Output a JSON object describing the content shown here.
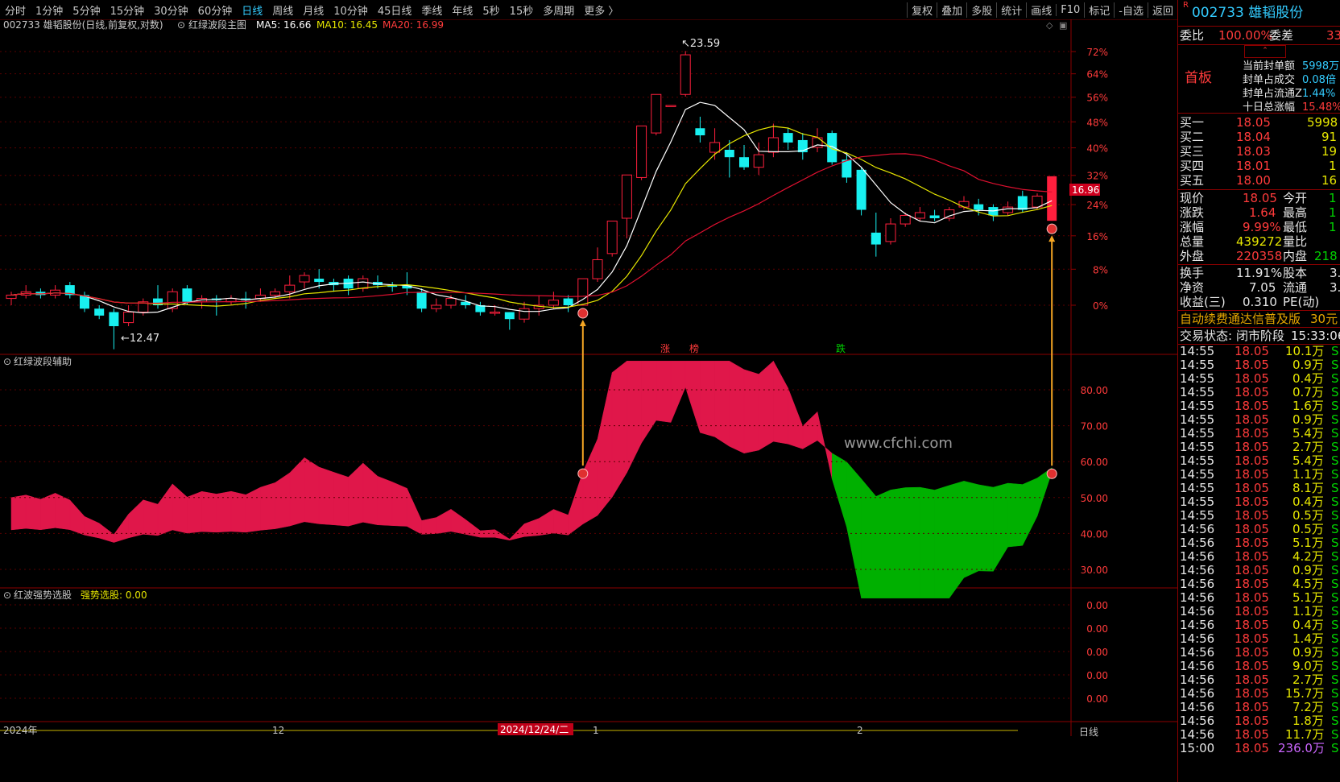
{
  "menu": {
    "left": [
      "分时",
      "1分钟",
      "5分钟",
      "15分钟",
      "30分钟",
      "60分钟",
      "日线",
      "周线",
      "月线",
      "10分钟",
      "45日线",
      "季线",
      "年线",
      "5秒",
      "15秒",
      "多周期",
      "更多 〉"
    ],
    "active": "日线",
    "right": [
      "复权",
      "叠加",
      "多股",
      "统计",
      "画线",
      "F10",
      "标记",
      "-自选",
      "返回"
    ]
  },
  "main_panel": {
    "title": "002733 雄韬股份(日线,前复权,对数)",
    "indicator": "红绿波段主图",
    "ma5": "MA5: 16.66",
    "ma10": "MA10: 16.45",
    "ma20": "MA20: 16.99",
    "high_label": "23.59",
    "low_label": "12.47",
    "price_tag": "16.96",
    "pct_ticks": [
      "72%",
      "64%",
      "56%",
      "48%",
      "40%",
      "32%",
      "24%",
      "16%",
      "8%",
      "0%"
    ],
    "event_labels": [
      "涨",
      "榜",
      "跌"
    ]
  },
  "aux_panel": {
    "title": "红绿波段辅助",
    "ticks": [
      "80.00",
      "70.00",
      "60.00",
      "50.00",
      "40.00",
      "30.00"
    ],
    "watermark": "www.cfchi.com"
  },
  "third_panel": {
    "title": "红波强势选股",
    "value_label": "强势选股: 0.00",
    "ticks": [
      "0.00",
      "0.00",
      "0.00",
      "0.00",
      "0.00"
    ]
  },
  "time_axis": {
    "labels": [
      "2024年",
      "12",
      "2024/12/24/二",
      "1",
      "2"
    ],
    "period": "日线"
  },
  "side": {
    "code": "002733",
    "name": "雄韬股份",
    "r_mark": "R",
    "weibi_label": "委比",
    "weibi_value": "100.00%",
    "weicha_label": "委差",
    "weicha_value": "33",
    "first_board": "首板",
    "seal_rows": [
      {
        "label": "当前封单额",
        "value": "5998万"
      },
      {
        "label": "封单占成交",
        "value": "0.08倍"
      },
      {
        "label": "封单占流通Z",
        "value": "1.44%"
      },
      {
        "label": "十日总涨幅",
        "value": "15.48%"
      }
    ],
    "bids": [
      {
        "label": "买一",
        "price": "18.05",
        "vol": "5998"
      },
      {
        "label": "买二",
        "price": "18.04",
        "vol": "91"
      },
      {
        "label": "买三",
        "price": "18.03",
        "vol": "19"
      },
      {
        "label": "买四",
        "price": "18.01",
        "vol": "1"
      },
      {
        "label": "买五",
        "price": "18.00",
        "vol": "16"
      }
    ],
    "quote_rows": [
      {
        "l1": "现价",
        "v1": "18.05",
        "l2": "今开",
        "v2": "1"
      },
      {
        "l1": "涨跌",
        "v1": "1.64",
        "l2": "最高",
        "v2": "1"
      },
      {
        "l1": "涨幅",
        "v1": "9.99%",
        "l2": "最低",
        "v2": "1"
      },
      {
        "l1": "总量",
        "v1": "439272",
        "l2": "量比",
        "v2": ""
      },
      {
        "l1": "外盘",
        "v1": "220358",
        "l2": "内盘",
        "v2": "218"
      }
    ],
    "stats_rows": [
      {
        "l1": "换手",
        "v1": "11.91%",
        "l2": "股本",
        "v2": "3."
      },
      {
        "l1": "净资",
        "v1": "7.05",
        "l2": "流通",
        "v2": "3."
      },
      {
        "l1": "收益(三)",
        "v1": "0.310",
        "l2": "PE(动)",
        "v2": ""
      }
    ],
    "promo": "自动续费通达信普及版",
    "promo_price": "30元",
    "trade_state_label": "交易状态:",
    "trade_state": "闭市阶段",
    "trade_time": "15:33:06",
    "ticks": [
      {
        "t": "14:55",
        "p": "18.05",
        "v": "10.1万",
        "s": "S"
      },
      {
        "t": "14:55",
        "p": "18.05",
        "v": "0.9万",
        "s": "S"
      },
      {
        "t": "14:55",
        "p": "18.05",
        "v": "0.4万",
        "s": "S"
      },
      {
        "t": "14:55",
        "p": "18.05",
        "v": "0.7万",
        "s": "S"
      },
      {
        "t": "14:55",
        "p": "18.05",
        "v": "1.6万",
        "s": "S"
      },
      {
        "t": "14:55",
        "p": "18.05",
        "v": "0.9万",
        "s": "S"
      },
      {
        "t": "14:55",
        "p": "18.05",
        "v": "5.4万",
        "s": "S"
      },
      {
        "t": "14:55",
        "p": "18.05",
        "v": "2.7万",
        "s": "S"
      },
      {
        "t": "14:55",
        "p": "18.05",
        "v": "5.4万",
        "s": "S"
      },
      {
        "t": "14:55",
        "p": "18.05",
        "v": "1.1万",
        "s": "S"
      },
      {
        "t": "14:55",
        "p": "18.05",
        "v": "8.1万",
        "s": "S"
      },
      {
        "t": "14:55",
        "p": "18.05",
        "v": "0.4万",
        "s": "S"
      },
      {
        "t": "14:55",
        "p": "18.05",
        "v": "0.5万",
        "s": "S"
      },
      {
        "t": "14:56",
        "p": "18.05",
        "v": "0.5万",
        "s": "S"
      },
      {
        "t": "14:56",
        "p": "18.05",
        "v": "5.1万",
        "s": "S"
      },
      {
        "t": "14:56",
        "p": "18.05",
        "v": "4.2万",
        "s": "S"
      },
      {
        "t": "14:56",
        "p": "18.05",
        "v": "0.9万",
        "s": "S"
      },
      {
        "t": "14:56",
        "p": "18.05",
        "v": "4.5万",
        "s": "S"
      },
      {
        "t": "14:56",
        "p": "18.05",
        "v": "5.1万",
        "s": "S"
      },
      {
        "t": "14:56",
        "p": "18.05",
        "v": "1.1万",
        "s": "S"
      },
      {
        "t": "14:56",
        "p": "18.05",
        "v": "0.4万",
        "s": "S"
      },
      {
        "t": "14:56",
        "p": "18.05",
        "v": "1.4万",
        "s": "S"
      },
      {
        "t": "14:56",
        "p": "18.05",
        "v": "0.9万",
        "s": "S"
      },
      {
        "t": "14:56",
        "p": "18.05",
        "v": "9.0万",
        "s": "S"
      },
      {
        "t": "14:56",
        "p": "18.05",
        "v": "2.7万",
        "s": "S"
      },
      {
        "t": "14:56",
        "p": "18.05",
        "v": "15.7万",
        "s": "S"
      },
      {
        "t": "14:56",
        "p": "18.05",
        "v": "7.2万",
        "s": "S"
      },
      {
        "t": "14:56",
        "p": "18.05",
        "v": "1.8万",
        "s": "S"
      },
      {
        "t": "14:56",
        "p": "18.05",
        "v": "11.7万",
        "s": "S"
      },
      {
        "t": "15:00",
        "p": "18.05",
        "v": "236.0万",
        "s": "S"
      }
    ]
  },
  "colors": {
    "up": "#ff1f3d",
    "down": "#18f0f0",
    "ma5": "#ffffff",
    "ma10": "#e6e600",
    "ma20": "#e01030",
    "fill_red": "#e0174a",
    "fill_green": "#00b000",
    "arrow": "#f5a623"
  },
  "candles": [
    [
      13.9,
      14.0,
      13.7,
      14.1
    ],
    [
      14.0,
      14.1,
      13.9,
      14.3
    ],
    [
      14.1,
      14.0,
      13.9,
      14.2
    ],
    [
      14.0,
      14.15,
      13.9,
      14.3
    ],
    [
      14.3,
      14.0,
      13.9,
      14.4
    ],
    [
      14.0,
      13.6,
      13.5,
      14.1
    ],
    [
      13.6,
      13.4,
      13.3,
      13.7
    ],
    [
      13.5,
      13.1,
      12.47,
      13.6
    ],
    [
      13.2,
      13.5,
      13.1,
      13.7
    ],
    [
      13.5,
      13.8,
      13.4,
      13.9
    ],
    [
      13.9,
      13.7,
      13.6,
      14.3
    ],
    [
      13.6,
      14.1,
      13.5,
      14.2
    ],
    [
      14.2,
      13.8,
      13.7,
      14.3
    ],
    [
      13.8,
      13.9,
      13.6,
      14.0
    ],
    [
      13.9,
      13.85,
      13.4,
      14.0
    ],
    [
      13.8,
      13.9,
      13.7,
      14.0
    ],
    [
      13.9,
      13.85,
      13.6,
      14.1
    ],
    [
      13.9,
      14.0,
      13.8,
      14.2
    ],
    [
      14.0,
      14.1,
      13.9,
      14.2
    ],
    [
      14.1,
      14.3,
      13.9,
      14.6
    ],
    [
      14.4,
      14.6,
      14.2,
      14.7
    ],
    [
      14.5,
      14.4,
      14.2,
      14.8
    ],
    [
      14.4,
      14.3,
      14.1,
      14.5
    ],
    [
      14.5,
      14.2,
      14.0,
      14.6
    ],
    [
      14.2,
      14.5,
      14.1,
      14.6
    ],
    [
      14.4,
      14.3,
      14.2,
      14.6
    ],
    [
      14.3,
      14.25,
      14.1,
      14.4
    ],
    [
      14.3,
      14.2,
      14.0,
      14.7
    ],
    [
      14.1,
      13.6,
      13.5,
      14.2
    ],
    [
      13.6,
      13.7,
      13.5,
      13.9
    ],
    [
      13.7,
      13.9,
      13.6,
      14.0
    ],
    [
      13.8,
      13.7,
      13.6,
      14.0
    ],
    [
      13.7,
      13.5,
      13.4,
      13.8
    ],
    [
      13.5,
      13.5,
      13.4,
      13.7
    ],
    [
      13.5,
      13.3,
      13.0,
      13.5
    ],
    [
      13.3,
      13.6,
      13.2,
      13.8
    ],
    [
      13.6,
      13.7,
      13.4,
      14.0
    ],
    [
      13.7,
      13.85,
      13.6,
      14.1
    ],
    [
      13.9,
      13.7,
      13.5,
      14.0
    ],
    [
      13.7,
      14.5,
      13.7,
      14.5
    ],
    [
      14.5,
      15.1,
      14.4,
      15.5
    ],
    [
      15.3,
      16.4,
      15.2,
      16.4
    ],
    [
      16.5,
      18.1,
      15.8,
      18.1
    ],
    [
      18.0,
      20.1,
      17.9,
      20.1
    ],
    [
      19.8,
      21.5,
      19.7,
      21.5
    ],
    [
      21.0,
      21.0,
      21.0,
      21.0
    ],
    [
      21.5,
      23.4,
      21.4,
      23.59
    ],
    [
      20.0,
      19.7,
      19.4,
      20.5
    ],
    [
      19.0,
      19.4,
      18.7,
      20.0
    ],
    [
      19.1,
      18.8,
      18.0,
      19.5
    ],
    [
      18.8,
      18.4,
      18.3,
      19.3
    ],
    [
      18.4,
      18.9,
      18.1,
      19.4
    ],
    [
      19.0,
      19.6,
      18.8,
      20.2
    ],
    [
      19.8,
      19.4,
      19.1,
      20.0
    ],
    [
      19.5,
      19.0,
      18.7,
      19.8
    ],
    [
      19.2,
      19.6,
      19.0,
      20.0
    ],
    [
      19.8,
      18.6,
      18.5,
      19.9
    ],
    [
      18.7,
      18.0,
      17.8,
      19.0
    ],
    [
      18.3,
      16.8,
      16.6,
      18.4
    ],
    [
      16.0,
      15.6,
      15.2,
      16.7
    ],
    [
      15.7,
      16.3,
      15.6,
      16.5
    ],
    [
      16.3,
      16.6,
      16.2,
      16.7
    ],
    [
      16.5,
      16.7,
      16.4,
      16.9
    ],
    [
      16.6,
      16.5,
      16.4,
      16.8
    ],
    [
      16.5,
      16.8,
      16.4,
      16.9
    ],
    [
      16.9,
      17.1,
      16.8,
      17.3
    ],
    [
      17.0,
      16.8,
      16.6,
      17.2
    ],
    [
      16.9,
      16.6,
      16.4,
      17.0
    ],
    [
      16.7,
      16.9,
      16.6,
      17.1
    ],
    [
      17.3,
      16.8,
      16.7,
      17.5
    ],
    [
      16.9,
      17.3,
      16.8,
      17.4
    ],
    [
      16.41,
      18.05,
      16.41,
      18.05
    ]
  ]
}
